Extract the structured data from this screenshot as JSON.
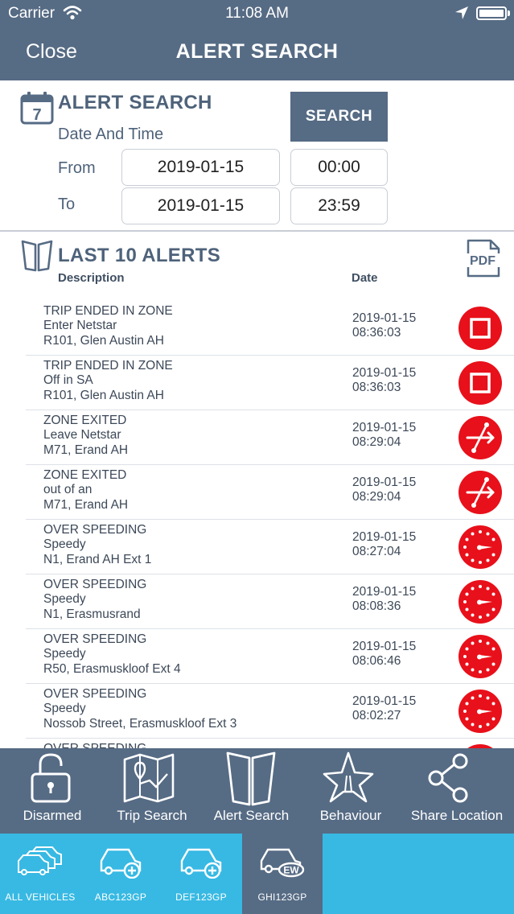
{
  "status_bar": {
    "carrier": "Carrier",
    "time": "11:08 AM"
  },
  "nav": {
    "close_label": "Close",
    "title": "ALERT SEARCH"
  },
  "search": {
    "section_title": "ALERT SEARCH",
    "subtitle": "Date And Time",
    "from_label": "From",
    "to_label": "To",
    "from_date": "2019-01-15",
    "from_time": "00:00",
    "to_date": "2019-01-15",
    "to_time": "23:59",
    "button_label": "SEARCH"
  },
  "alerts": {
    "section_title": "LAST 10 ALERTS",
    "col_description": "Description",
    "col_date": "Date",
    "rows": [
      {
        "type": "TRIP ENDED IN ZONE",
        "name": "Enter Netstar",
        "location": "R101, Glen Austin AH",
        "date": "2019-01-15",
        "time": "08:36:03",
        "icon": "stop-icon"
      },
      {
        "type": "TRIP ENDED IN ZONE",
        "name": "Off in SA",
        "location": "R101, Glen Austin AH",
        "date": "2019-01-15",
        "time": "08:36:03",
        "icon": "stop-icon"
      },
      {
        "type": "ZONE EXITED",
        "name": "Leave Netstar",
        "location": "M71, Erand AH",
        "date": "2019-01-15",
        "time": "08:29:04",
        "icon": "zone-exit-icon"
      },
      {
        "type": "ZONE EXITED",
        "name": "out of an",
        "location": "M71, Erand AH",
        "date": "2019-01-15",
        "time": "08:29:04",
        "icon": "zone-exit-icon"
      },
      {
        "type": "OVER SPEEDING",
        "name": "Speedy",
        "location": "N1, Erand AH Ext 1",
        "date": "2019-01-15",
        "time": "08:27:04",
        "icon": "speedometer-icon"
      },
      {
        "type": "OVER SPEEDING",
        "name": "Speedy",
        "location": "N1, Erasmusrand",
        "date": "2019-01-15",
        "time": "08:08:36",
        "icon": "speedometer-icon"
      },
      {
        "type": "OVER SPEEDING",
        "name": "Speedy",
        "location": "R50, Erasmuskloof Ext 4",
        "date": "2019-01-15",
        "time": "08:06:46",
        "icon": "speedometer-icon"
      },
      {
        "type": "OVER SPEEDING",
        "name": "Speedy",
        "location": "Nossob Street, Erasmuskloof Ext 3",
        "date": "2019-01-15",
        "time": "08:02:27",
        "icon": "speedometer-icon"
      },
      {
        "type": "OVER SPEEDING",
        "name": "",
        "location": "",
        "date": "",
        "time": "",
        "icon": "speedometer-icon"
      }
    ]
  },
  "tabbar": {
    "items": [
      {
        "label": "Disarmed",
        "icon": "unlock-icon"
      },
      {
        "label": "Trip Search",
        "icon": "map-icon"
      },
      {
        "label": "Alert Search",
        "icon": "alert-book-icon"
      },
      {
        "label": "Behaviour",
        "icon": "road-icon"
      },
      {
        "label": "Share Location",
        "icon": "share-icon"
      }
    ]
  },
  "vehicles": {
    "items": [
      {
        "label": "ALL VEHICLES",
        "icon": "all-vehicles-icon",
        "selected": false
      },
      {
        "label": "ABC123GP",
        "icon": "car-add-icon",
        "selected": false
      },
      {
        "label": "DEF123GP",
        "icon": "car-add-icon",
        "selected": false
      },
      {
        "label": "GHI123GP",
        "icon": "car-ew-icon",
        "selected": true,
        "badge": "EW"
      }
    ]
  },
  "colors": {
    "header": "#566b84",
    "accent_blue": "#37b9e3",
    "alert_red": "#e8101a"
  }
}
